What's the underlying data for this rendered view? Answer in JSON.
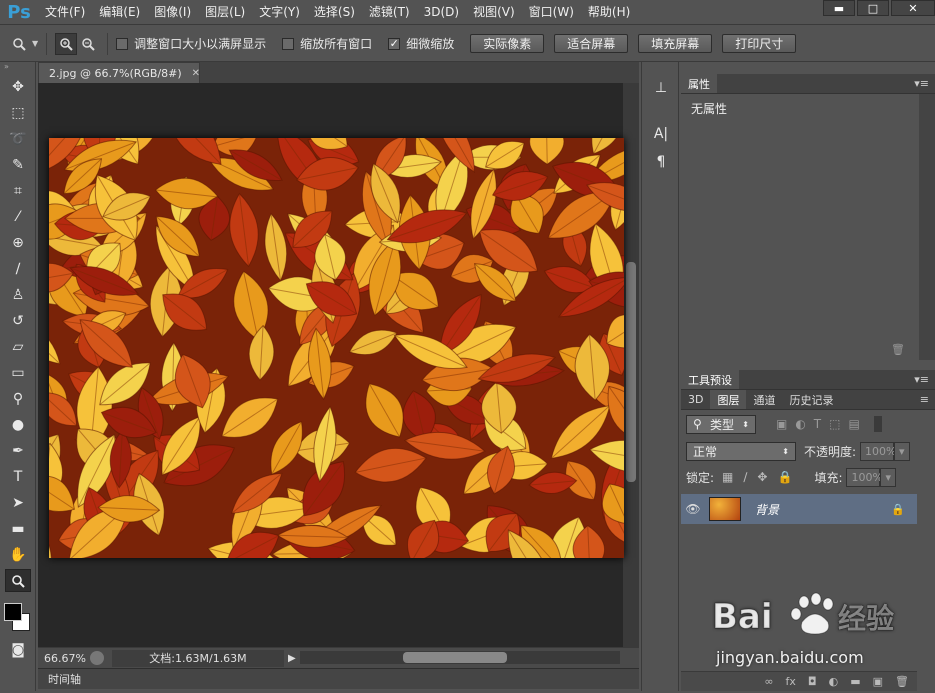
{
  "app": {
    "logo": "Ps"
  },
  "menu": [
    "文件(F)",
    "编辑(E)",
    "图像(I)",
    "图层(L)",
    "文字(Y)",
    "选择(S)",
    "滤镜(T)",
    "3D(D)",
    "视图(V)",
    "窗口(W)",
    "帮助(H)"
  ],
  "window_controls": {
    "minimize": "▬",
    "maximize": "□",
    "close": "✕"
  },
  "options": {
    "resize_windows": {
      "label": "调整窗口大小以满屏显示",
      "checked": false
    },
    "zoom_all": {
      "label": "缩放所有窗口",
      "checked": false
    },
    "scrubby_zoom": {
      "label": "细微缩放",
      "checked": true
    },
    "buttons": [
      "实际像素",
      "适合屏幕",
      "填充屏幕",
      "打印尺寸"
    ]
  },
  "document": {
    "tab_title": "2.jpg @ 66.7%(RGB/8#)",
    "zoom": "66.67%",
    "info": "文档:1.63M/1.63M"
  },
  "timeline_label": "时间轴",
  "properties": {
    "tab": "属性",
    "body": "无属性"
  },
  "tool_presets_tab": "工具预设",
  "layers_panel": {
    "tabs": [
      "3D",
      "图层",
      "通道",
      "历史记录"
    ],
    "filter_kind": "类型",
    "blend_mode": "正常",
    "opacity_label": "不透明度:",
    "opacity_value": "100%",
    "lock_label": "锁定:",
    "fill_label": "填充:",
    "fill_value": "100%",
    "layer_name": "背景"
  },
  "watermark": {
    "logo": "Bai 经验",
    "url": "jingyan.baidu.com"
  },
  "colors": {
    "foreground": "#000000",
    "background": "#ffffff",
    "brand": "#3a9fd6"
  }
}
